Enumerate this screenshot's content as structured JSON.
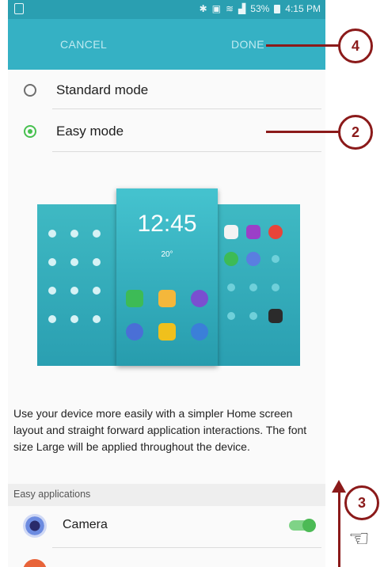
{
  "status_bar": {
    "battery": "53%",
    "time": "4:15 PM"
  },
  "toolbar": {
    "cancel_label": "CANCEL",
    "done_label": "DONE"
  },
  "options": [
    {
      "label": "Standard mode",
      "selected": false
    },
    {
      "label": "Easy mode",
      "selected": true
    }
  ],
  "preview": {
    "clock": "12:45",
    "weather": "20°"
  },
  "description": "Use your device more easily with a simpler Home screen layout and straight forward application interactions. The font size Large will be applied throughout the device.",
  "section_header": "Easy applications",
  "apps": [
    {
      "name": "Camera",
      "toggle": "ON",
      "icon": "camera-icon"
    }
  ],
  "annotations": [
    "4",
    "2",
    "3"
  ],
  "colors": {
    "header": "#35b1c4",
    "accent": "#47c04f",
    "annotation": "#8b1a1a"
  }
}
